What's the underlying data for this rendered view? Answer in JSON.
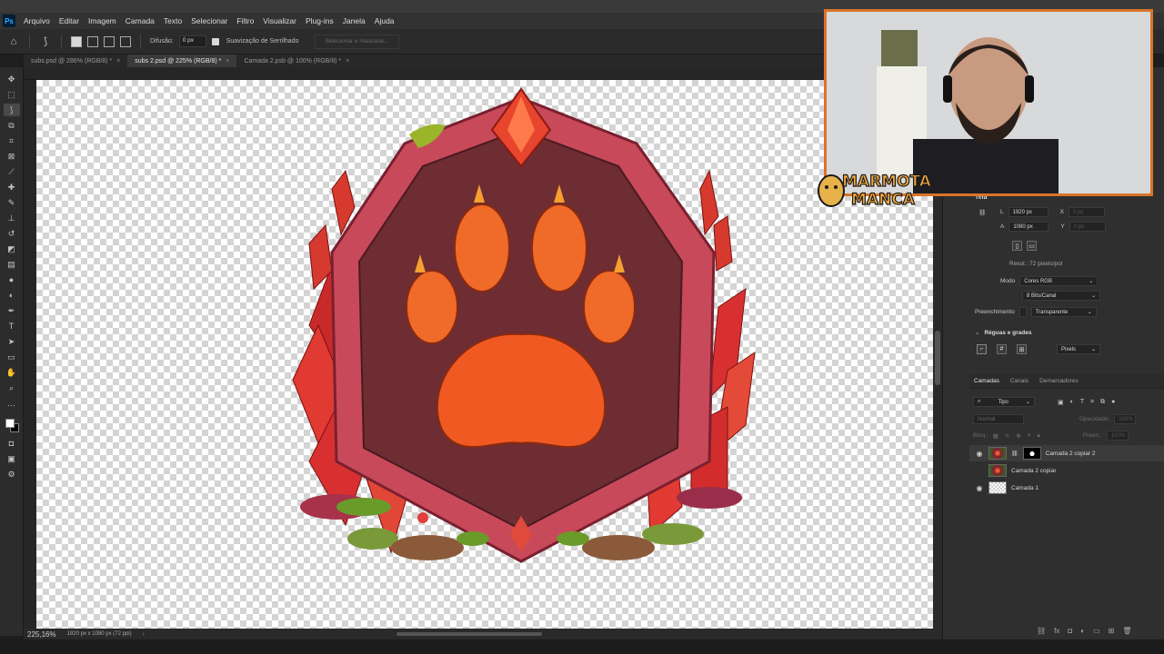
{
  "app": {
    "logo": "Ps",
    "menu": [
      "Arquivo",
      "Editar",
      "Imagem",
      "Camada",
      "Texto",
      "Selecionar",
      "Filtro",
      "Visualizar",
      "Plug-ins",
      "Janela",
      "Ajuda"
    ]
  },
  "options_bar": {
    "feather_label": "Difusão:",
    "feather_value": "0 px",
    "antialias_label": "Suavização de Serrilhado",
    "select_mask_button": "Selecionar e mascarar..."
  },
  "tabs": [
    {
      "label": "subs.psd @ 286% (RGB/8) *",
      "active": false
    },
    {
      "label": "subs 2.psd @ 225% (RGB/8) *",
      "active": true
    },
    {
      "label": "Camada 2.psb @ 100% (RGB/8) *",
      "active": false
    }
  ],
  "status": {
    "zoom": "225,16%",
    "doc_info": "1920 px x 1080 px (72 ppi)"
  },
  "properties": {
    "section_partial_title": "Tela",
    "width_label": "L",
    "width_value": "1920 px",
    "height_label": "A",
    "height_value": "1080 px",
    "x_label": "X",
    "x_value": "0 px",
    "y_label": "Y",
    "y_value": "0 px",
    "resolution": "Resol.: 72 pixels/pol",
    "mode_label": "Modo",
    "mode_value": "Cores RGB",
    "bit_depth": "8 Bits/Canal",
    "fill_label": "Preenchimento",
    "fill_value": "Transparente",
    "rulers_title": "Réguas e grades",
    "units_value": "Pixels"
  },
  "layers_panel": {
    "tabs": [
      "Camadas",
      "Canais",
      "Demarcadores"
    ],
    "filter_label": "Tipo",
    "blend_mode": "Normal",
    "opacity_label": "Opacidade:",
    "opacity_value": "100%",
    "lock_label": "Bloq.:",
    "fill_label": "Preen.:",
    "fill_value": "100%",
    "layers": [
      {
        "name": "Camada 2 copiar 2",
        "visible": true,
        "selected": true,
        "has_mask": true
      },
      {
        "name": "Camada 2 copiar",
        "visible": false,
        "selected": false,
        "has_mask": false
      },
      {
        "name": "Camada 1",
        "visible": true,
        "selected": false,
        "has_mask": false
      }
    ]
  },
  "overlay": {
    "brand_line1": "MARMOTA",
    "brand_line2": "MANCA"
  },
  "colors": {
    "accent": "#d8742a",
    "badge_frame": "#c84a5a",
    "badge_inner": "#6e2c33",
    "paw": "#f06a2a",
    "crystal": "#d83030",
    "leaf": "#5a8a2a"
  }
}
